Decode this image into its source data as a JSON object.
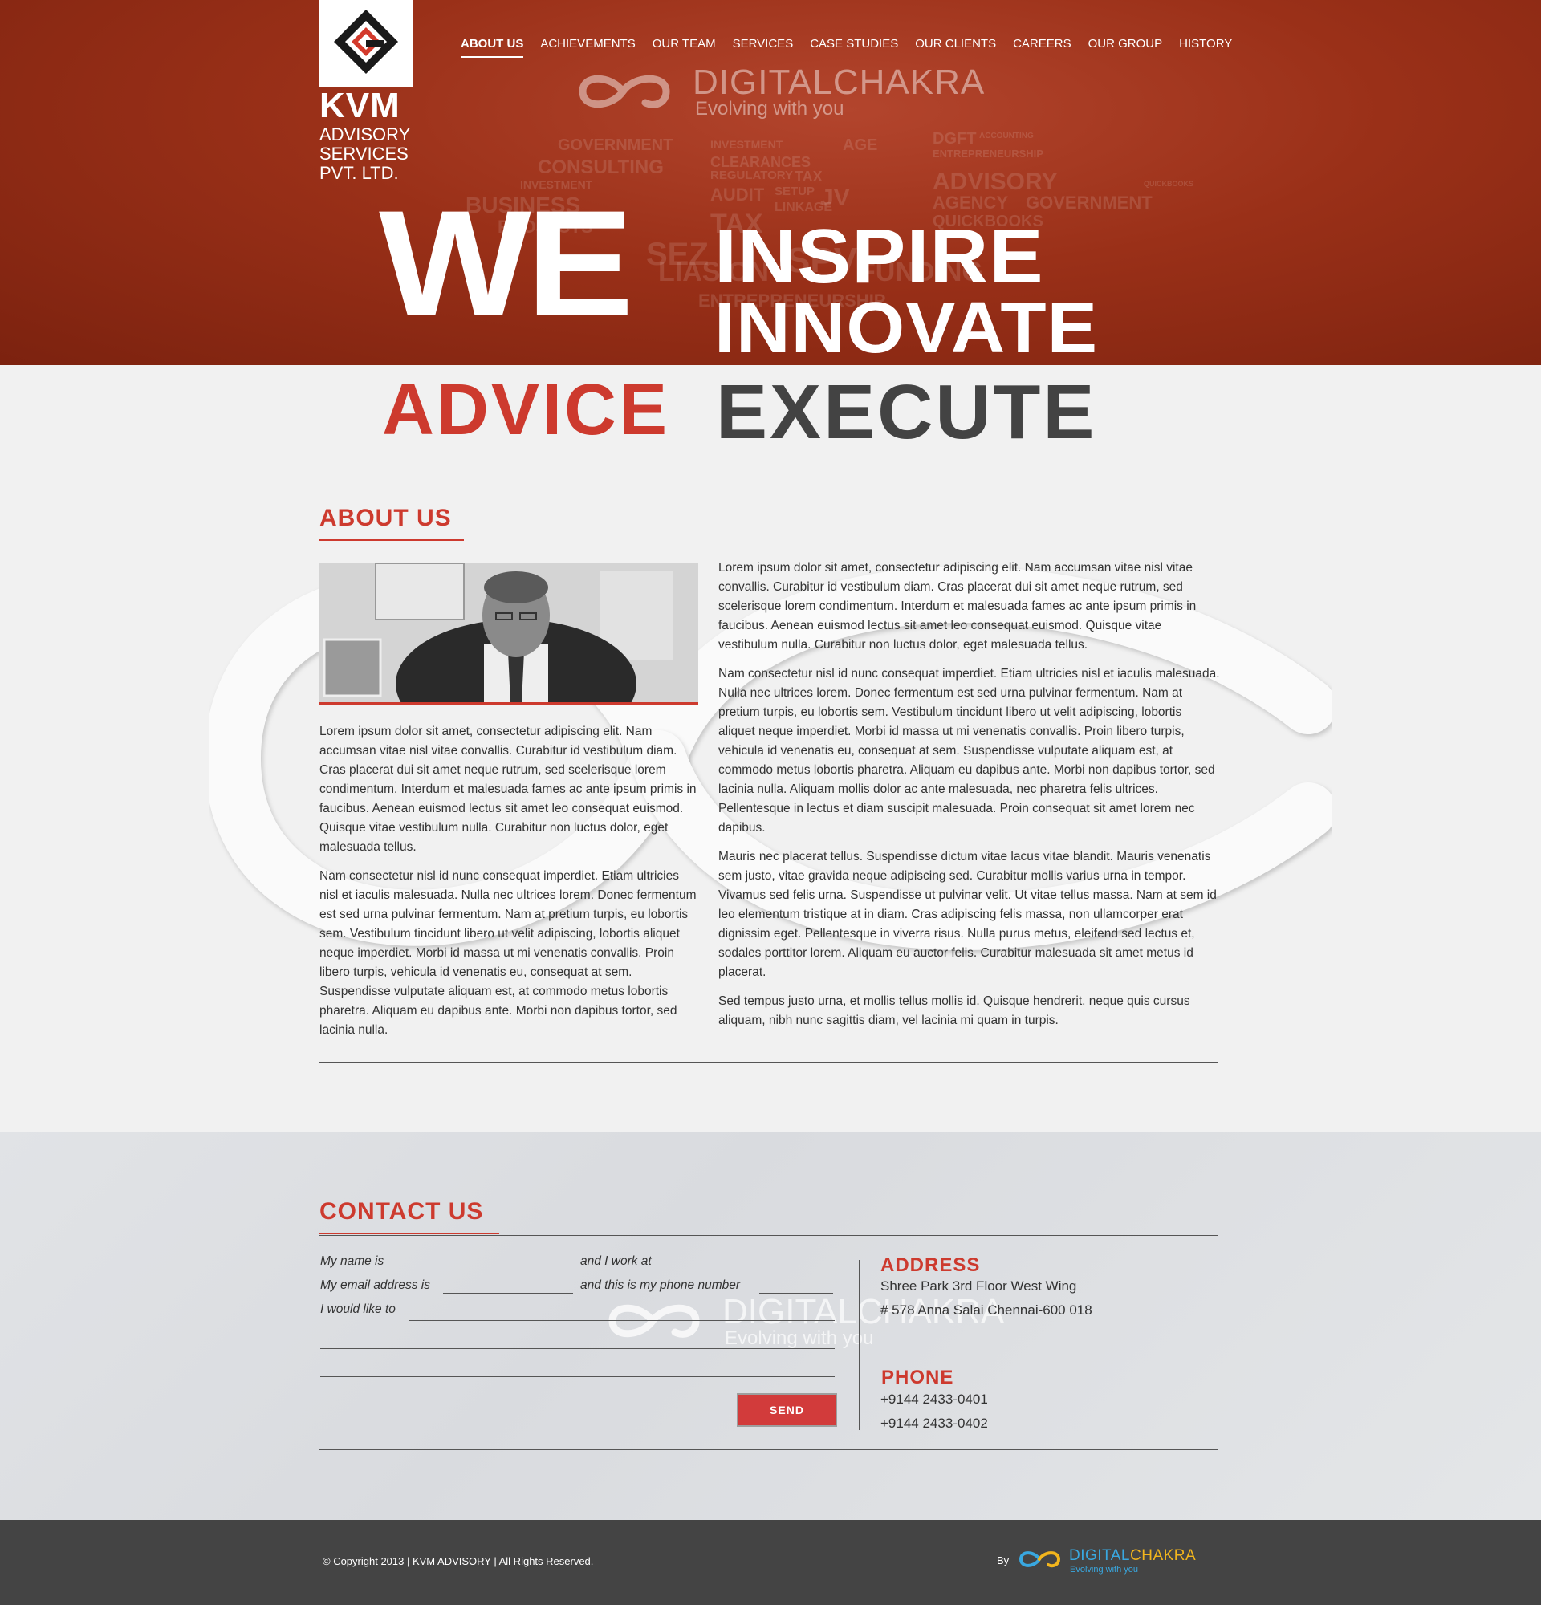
{
  "logo": {
    "name": "KVM",
    "sub": [
      "ADVISORY",
      "SERVICES",
      "PVT. LTD."
    ]
  },
  "nav": [
    "ABOUT US",
    "ACHIEVEMENTS",
    "OUR TEAM",
    "SERVICES",
    "CASE STUDIES",
    "OUR CLIENTS",
    "CAREERS",
    "OUR GROUP",
    "HISTORY"
  ],
  "brand": {
    "name": "DIGITALCHAKRA",
    "tagline": "Evolving with you"
  },
  "hero": {
    "we": "WE",
    "inspire": "INSPIRE",
    "innovate": "INNOVATE",
    "advice": "ADVICE",
    "execute": "EXECUTE",
    "word_cloud": [
      "GOVERNMENT",
      "CONSULTING",
      "INVESTMENT",
      "BUSINESS",
      "PROJECTS",
      "INVESTMENT",
      "CLEARANCES",
      "REGULATORY",
      "TAX",
      "AUDIT",
      "SETUP",
      "LINKAGE",
      "TAX",
      "SEZ",
      "ENTREPRENEURSHIP",
      "DGFT",
      "ACCOUNTING",
      "ENTREPRENEURSHIP",
      "ADVISORY",
      "QUICKBOOKS",
      "AGENCY",
      "GOVERNMENT",
      "QUICKBOOKS",
      "SPV",
      "FUNDING",
      "LIASION",
      "AGE",
      "JV"
    ]
  },
  "about": {
    "title": "ABOUT US",
    "left": [
      "Lorem ipsum dolor sit amet, consectetur adipiscing elit. Nam accumsan vitae nisl vitae convallis. Curabitur id vestibulum diam. Cras placerat dui sit amet neque rutrum, sed scelerisque lorem condimentum. Interdum et malesuada fames ac ante ipsum primis in faucibus. Aenean euismod lectus sit amet leo consequat euismod. Quisque vitae vestibulum nulla. Curabitur non luctus dolor, eget malesuada tellus.",
      "Nam consectetur nisl id nunc consequat imperdiet. Etiam ultricies nisl et iaculis malesuada. Nulla nec ultrices lorem. Donec fermentum est sed urna pulvinar fermentum. Nam at pretium turpis, eu lobortis sem. Vestibulum tincidunt libero ut velit adipiscing, lobortis aliquet neque imperdiet. Morbi id massa ut mi venenatis convallis. Proin libero turpis, vehicula id venenatis eu, consequat at sem. Suspendisse vulputate aliquam est, at commodo metus lobortis pharetra. Aliquam eu dapibus ante. Morbi non dapibus tortor, sed lacinia nulla."
    ],
    "right": [
      "Lorem ipsum dolor sit amet, consectetur adipiscing elit. Nam accumsan vitae nisl vitae convallis. Curabitur id vestibulum diam. Cras placerat dui sit amet neque rutrum, sed scelerisque lorem condimentum. Interdum et malesuada fames ac ante ipsum primis in faucibus. Aenean euismod lectus sit amet leo consequat euismod. Quisque vitae vestibulum nulla. Curabitur non luctus dolor, eget malesuada tellus.",
      "Nam consectetur nisl id nunc consequat imperdiet. Etiam ultricies nisl et iaculis malesuada. Nulla nec ultrices lorem. Donec fermentum est sed urna pulvinar fermentum. Nam at pretium turpis, eu lobortis sem. Vestibulum tincidunt libero ut velit adipiscing, lobortis aliquet neque imperdiet. Morbi id massa ut mi venenatis convallis. Proin libero turpis, vehicula id venenatis eu, consequat at sem. Suspendisse vulputate aliquam est, at commodo metus lobortis pharetra. Aliquam eu dapibus ante. Morbi non dapibus tortor, sed lacinia nulla. Aliquam mollis dolor ac ante malesuada, nec pharetra felis ultrices. Pellentesque in lectus et diam suscipit malesuada. Proin consequat sit amet lorem nec dapibus.",
      "Mauris nec placerat tellus. Suspendisse dictum vitae lacus vitae blandit. Mauris venenatis sem justo, vitae gravida neque adipiscing sed. Curabitur mollis varius urna in tempor. Vivamus sed felis urna. Suspendisse ut pulvinar velit. Ut vitae tellus massa. Nam at sem id leo elementum tristique at in diam. Cras adipiscing felis massa, non ullamcorper erat dignissim eget. Pellentesque in viverra risus. Nulla purus metus, eleifend sed lectus et, sodales porttitor lorem. Aliquam eu auctor felis. Curabitur malesuada sit amet metus id placerat.",
      "Sed tempus justo urna, et mollis tellus mollis id. Quisque hendrerit, neque quis cursus aliquam, nibh nunc sagittis diam, vel lacinia mi quam in turpis."
    ]
  },
  "contact": {
    "title": "CONTACT US",
    "form": {
      "name_label": "My name is",
      "work_label": "and I work at",
      "email_label": "My email address is",
      "phone_label": "and this is my phone number",
      "like_label": "I would like to",
      "send": "SEND"
    },
    "address_title": "ADDRESS",
    "address": [
      "Shree Park 3rd Floor West Wing",
      "# 578 Anna Salai Chennai-600 018"
    ],
    "phone_title": "PHONE",
    "phones": [
      "+9144 2433-0401",
      "+9144 2433-0402"
    ]
  },
  "footer": {
    "copyright": "© Copyright 2013 | KVM ADVISORY | All Rights Reserved.",
    "by": "By",
    "brand_a": "DIGITAL",
    "brand_b": "CHAKRA",
    "tagline": "Evolving with you"
  },
  "colors": {
    "accent": "#cd3a2e",
    "hero": "#9a3018",
    "dark": "#434343",
    "footer": "#444444",
    "brand_blue": "#39a8e0",
    "brand_gold": "#f2b51d"
  }
}
